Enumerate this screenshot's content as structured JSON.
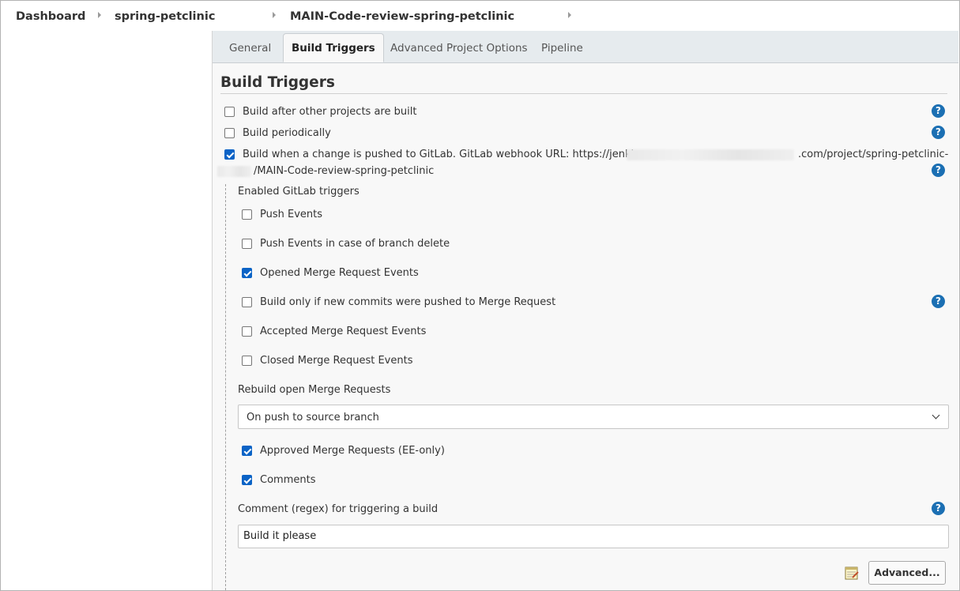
{
  "breadcrumb": {
    "items": [
      "Dashboard",
      "spring-petclinic",
      "MAIN-Code-review-spring-petclinic"
    ]
  },
  "tabs": [
    {
      "label": "General",
      "active": false
    },
    {
      "label": "Build Triggers",
      "active": true
    },
    {
      "label": "Advanced Project Options",
      "active": false
    },
    {
      "label": "Pipeline",
      "active": false
    }
  ],
  "section": {
    "title": "Build Triggers"
  },
  "triggers": [
    {
      "label": "Build after other projects are built",
      "checked": false
    },
    {
      "label": "Build periodically",
      "checked": false
    },
    {
      "label": "Build when a change is pushed to GitLab. GitLab webhook URL: https://jenkins-",
      "url_part2": ".com/project/spring-petclinic-",
      "url_part3": "/MAIN-Code-review-spring-petclinic",
      "checked": true
    }
  ],
  "gitlab": {
    "heading": "Enabled GitLab triggers",
    "options": [
      {
        "label": "Push Events",
        "checked": false
      },
      {
        "label": "Push Events in case of branch delete",
        "checked": false
      },
      {
        "label": "Opened Merge Request Events",
        "checked": true
      },
      {
        "label": "Build only if new commits were pushed to Merge Request",
        "checked": false
      },
      {
        "label": "Accepted Merge Request Events",
        "checked": false
      },
      {
        "label": "Closed Merge Request Events",
        "checked": false
      }
    ],
    "rebuild_label": "Rebuild open Merge Requests",
    "rebuild_value": "On push to source branch",
    "extra_options": [
      {
        "label": "Approved Merge Requests (EE-only)",
        "checked": true
      },
      {
        "label": "Comments",
        "checked": true
      }
    ],
    "comment_label": "Comment (regex) for triggering a build",
    "comment_value": "Build it please",
    "advanced_button": "Advanced..."
  },
  "help_glyph": "?",
  "colors": {
    "accent": "#0b63c6",
    "help": "#1b6fb3",
    "tabbar": "#e6ebee"
  }
}
